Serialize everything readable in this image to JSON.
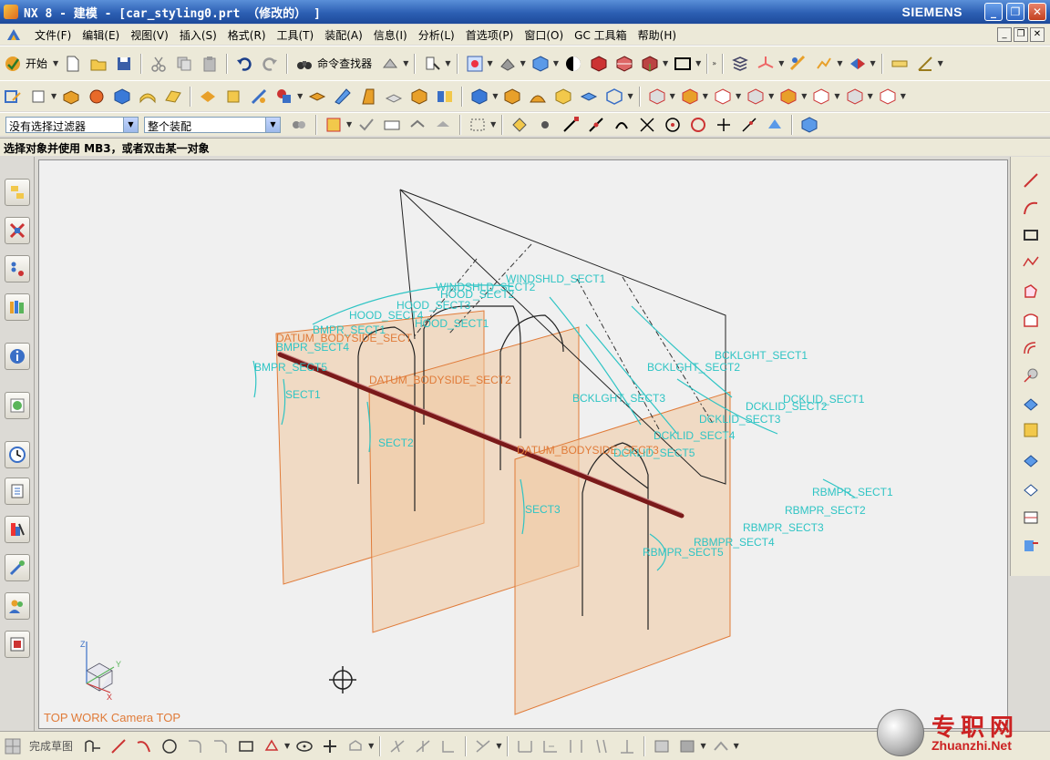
{
  "window": {
    "title": "NX 8 - 建模 - [car_styling0.prt （修改的） ]",
    "brand": "SIEMENS",
    "buttons": {
      "minimize": "_",
      "maximize": "❐",
      "close": "✕"
    }
  },
  "menu": {
    "items": [
      "文件(F)",
      "编辑(E)",
      "视图(V)",
      "插入(S)",
      "格式(R)",
      "工具(T)",
      "装配(A)",
      "信息(I)",
      "分析(L)",
      "首选项(P)",
      "窗口(O)",
      "GC 工具箱",
      "帮助(H)"
    ]
  },
  "toolbar": {
    "start_label": "开始",
    "command_finder_label": "命令查找器",
    "more": "»"
  },
  "selection": {
    "filter_value": "没有选择过滤器",
    "scope_value": "整个装配"
  },
  "prompt": {
    "text": "选择对象并使用 MB3，或者双击某一对象"
  },
  "viewport": {
    "view_label": "TOP WORK Camera TOP",
    "triad": {
      "x": "X",
      "y": "Y",
      "z": "Z"
    },
    "colors": {
      "datum_plane_fill": "#f0c8a0",
      "datum_plane_edge": "#e07b39",
      "section_curve": "#2ec4c4",
      "centerline": "#7a1a1a"
    },
    "labels": {
      "windshld_sect1": "WINDSHLD_SECT1",
      "windshld_sect2": "WINDSHLD_SECT2",
      "hood_sect1": "HOOD_SECT1",
      "hood_sect2": "HOOD_SECT2",
      "hood_sect3": "HOOD_SECT3",
      "hood_sect4": "HOOD_SECT4",
      "bmpr_sect1": "BMPR_SECT1",
      "bmpr_sect4": "BMPR_SECT4",
      "bmpr_sect5": "BMPR_SECT5",
      "datum_bodyside_sect": "DATUM_BODYSIDE_SECT",
      "datum_bodyside_sect2": "DATUM_BODYSIDE_SECT2",
      "datum_bodyside_sect3": "DATUM_BODYSIDE_SECT3",
      "sect1": "SECT1",
      "sect2": "SECT2",
      "sect3": "SECT3",
      "bcklght_sect1": "BCKLGHT_SECT1",
      "bcklght_sect2": "BCKLGHT_SECT2",
      "bcklght_sect3": "BCKLGHT_SECT3",
      "dcklid_sect1": "DCKLID_SECT1",
      "dcklid_sect2": "DCKLID_SECT2",
      "dcklid_sect3": "DCKLID_SECT3",
      "dcklid_sect4": "DCKLID_SECT4",
      "dcklid_sect5": "DCKLID_SECT5",
      "rbmpr_sect1": "RBMPR_SECT1",
      "rbmpr_sect2": "RBMPR_SECT2",
      "rbmpr_sect3": "RBMPR_SECT3",
      "rbmpr_sect4": "RBMPR_SECT4",
      "rbmpr_sect5": "RBMPR_SECT5"
    }
  },
  "sketch_toolbar": {
    "finish_label": "完成草图"
  },
  "watermark": {
    "cn": "专职网",
    "en": "Zhuanzhi.Net"
  }
}
